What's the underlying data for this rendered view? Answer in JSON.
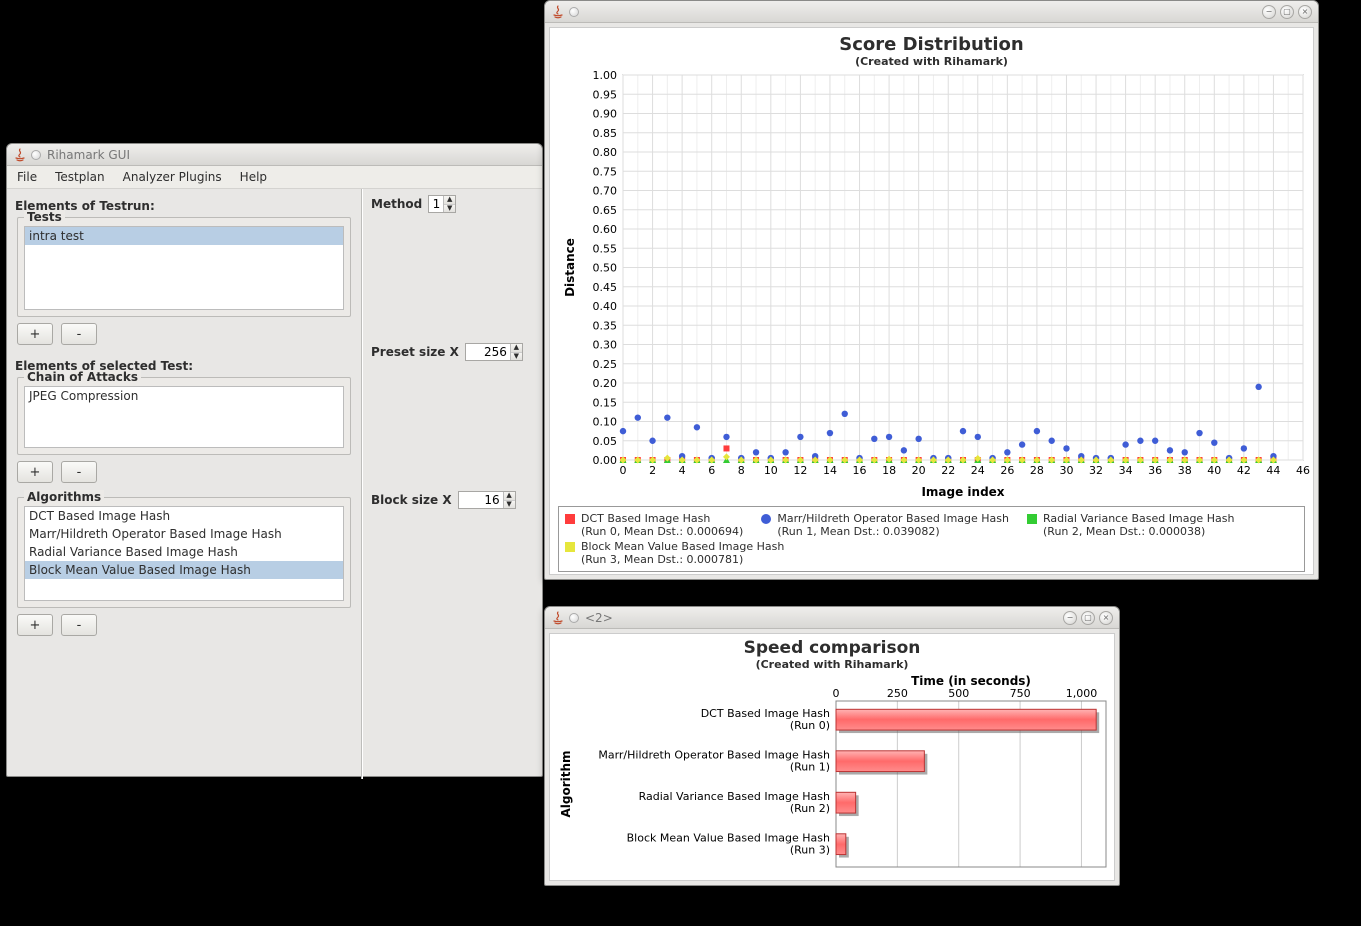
{
  "windows": {
    "main": {
      "title": "Rihamark GUI"
    },
    "score": {
      "title": ""
    },
    "speed": {
      "title": "<2>"
    }
  },
  "menubar": [
    "File",
    "Testplan",
    "Analyzer Plugins",
    "Help"
  ],
  "left": {
    "elements_label": "Elements of Testrun:",
    "tests_legend": "Tests",
    "tests": [
      "intra test"
    ],
    "tests_selected": 0,
    "selected_label": "Elements of selected Test:",
    "chain_legend": "Chain of Attacks",
    "chain": [
      "JPEG Compression"
    ],
    "algos_legend": "Algorithms",
    "algos": [
      "DCT Based Image Hash",
      "Marr/Hildreth Operator Based Image Hash",
      "Radial Variance Based Image Hash",
      "Block Mean Value Based Image Hash"
    ],
    "algos_selected": 3,
    "plus": "+",
    "minus": "-"
  },
  "right": {
    "method_label": "Method",
    "method_value": "1",
    "preset_label": "Preset size X",
    "preset_value": "256",
    "block_label": "Block size X",
    "block_value": "16"
  },
  "chart_data": [
    {
      "type": "scatter",
      "title": "Score Distribution",
      "subtitle": "(Created with Rihamark)",
      "xlabel": "Image index",
      "ylabel": "Distance",
      "xlim": [
        0,
        46
      ],
      "ylim": [
        0.0,
        1.0
      ],
      "xticks": [
        0,
        2,
        4,
        6,
        8,
        10,
        12,
        14,
        16,
        18,
        20,
        22,
        24,
        26,
        28,
        30,
        32,
        34,
        36,
        38,
        40,
        42,
        44,
        46
      ],
      "yticks": [
        0.0,
        0.05,
        0.1,
        0.15,
        0.2,
        0.25,
        0.3,
        0.35,
        0.4,
        0.45,
        0.5,
        0.55,
        0.6,
        0.65,
        0.7,
        0.75,
        0.8,
        0.85,
        0.9,
        0.95,
        1.0
      ],
      "series": [
        {
          "name": "DCT Based Image Hash",
          "sub": "(Run 0, Mean Dst.: 0.000694)",
          "marker": "square",
          "color": "#ff3c3c",
          "values": [
            0.0,
            0.0,
            0.0,
            0.0,
            0.0,
            0.0,
            0.0,
            0.03,
            0.0,
            0.0,
            0.0,
            0.0,
            0.0,
            0.0,
            0.0,
            0.0,
            0.0,
            0.0,
            0.0,
            0.0,
            0.0,
            0.0,
            0.0,
            0.0,
            0.0,
            0.0,
            0.0,
            0.0,
            0.0,
            0.0,
            0.0,
            0.0,
            0.0,
            0.0,
            0.0,
            0.0,
            0.0,
            0.0,
            0.0,
            0.0,
            0.0,
            0.0,
            0.0,
            0.0,
            0.0
          ]
        },
        {
          "name": "Marr/Hildreth Operator Based Image Hash",
          "sub": "(Run 1, Mean Dst.: 0.039082)",
          "marker": "circle",
          "color": "#3f5dd6",
          "values": [
            0.075,
            0.11,
            0.05,
            0.11,
            0.01,
            0.085,
            0.005,
            0.06,
            0.005,
            0.02,
            0.005,
            0.02,
            0.06,
            0.01,
            0.07,
            0.12,
            0.005,
            0.055,
            0.06,
            0.025,
            0.055,
            0.005,
            0.005,
            0.075,
            0.06,
            0.005,
            0.02,
            0.04,
            0.075,
            0.05,
            0.03,
            0.01,
            0.005,
            0.005,
            0.04,
            0.05,
            0.05,
            0.025,
            0.02,
            0.07,
            0.045,
            0.005,
            0.03,
            0.19,
            0.01
          ]
        },
        {
          "name": "Radial Variance Based Image Hash",
          "sub": "(Run 2, Mean Dst.: 0.000038)",
          "marker": "triangle",
          "color": "#33cc33",
          "values": [
            0.0,
            0.0,
            0.0,
            0.0,
            0.0,
            0.0,
            0.0,
            0.0,
            0.0,
            0.0,
            0.0,
            0.0,
            0.0,
            0.0,
            0.0,
            0.0,
            0.0,
            0.0,
            0.0,
            0.0,
            0.0,
            0.0,
            0.0,
            0.0,
            0.0,
            0.0,
            0.0,
            0.0,
            0.0,
            0.0,
            0.0,
            0.0,
            0.0,
            0.0,
            0.0,
            0.0,
            0.0,
            0.0,
            0.0,
            0.0,
            0.0,
            0.0,
            0.0,
            0.0,
            0.0
          ]
        },
        {
          "name": "Block Mean Value Based Image Hash",
          "sub": "(Run 3, Mean Dst.: 0.000781)",
          "marker": "diamond",
          "color": "#e6e63c",
          "values": [
            0.0,
            0.0,
            0.0,
            0.005,
            0.0,
            0.0,
            0.0,
            0.008,
            0.0,
            0.0,
            0.0,
            0.0,
            0.0,
            0.0,
            0.0,
            0.0,
            0.0,
            0.0,
            0.002,
            0.0,
            0.0,
            0.0,
            0.0,
            0.0,
            0.004,
            0.0,
            0.0,
            0.0,
            0.0,
            0.0,
            0.0,
            0.0,
            0.0,
            0.0,
            0.0,
            0.0,
            0.0,
            0.0,
            0.0,
            0.0,
            0.0,
            0.0,
            0.0,
            0.0,
            0.0
          ]
        }
      ]
    },
    {
      "type": "bar",
      "orientation": "horizontal",
      "title": "Speed comparison",
      "subtitle": "(Created with Rihamark)",
      "xlabel": "Time (in seconds)",
      "ylabel": "Algorithm",
      "xlim": [
        0,
        1100
      ],
      "xticks": [
        0,
        250,
        500,
        750,
        1000
      ],
      "categories": [
        [
          "DCT Based Image Hash",
          "(Run 0)"
        ],
        [
          "Marr/Hildreth Operator Based Image Hash",
          "(Run 1)"
        ],
        [
          "Radial Variance Based Image Hash",
          "(Run 2)"
        ],
        [
          "Block Mean Value Based Image Hash",
          "(Run 3)"
        ]
      ],
      "values": [
        1060,
        360,
        80,
        40
      ],
      "color": "#ff6a6a"
    }
  ]
}
